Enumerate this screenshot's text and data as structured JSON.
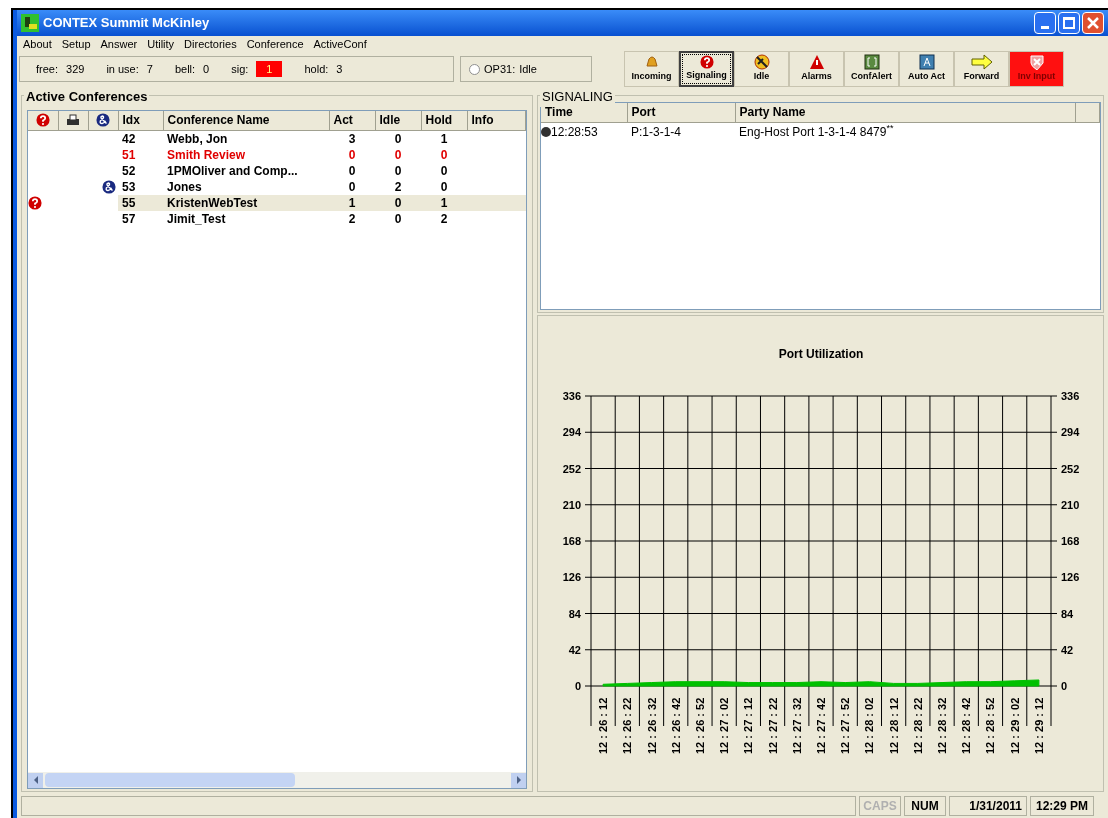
{
  "window": {
    "title": "CONTEX Summit McKinley"
  },
  "menu": [
    "About",
    "Setup",
    "Answer",
    "Utility",
    "Directories",
    "Conference",
    "ActiveConf"
  ],
  "counters": [
    {
      "label": "free:",
      "value": "329",
      "alert": false
    },
    {
      "label": "in use:",
      "value": "7",
      "alert": false
    },
    {
      "label": "bell:",
      "value": "0",
      "alert": false
    },
    {
      "label": "sig:",
      "value": "1",
      "alert": true
    },
    {
      "label": "hold:",
      "value": "3",
      "alert": false
    }
  ],
  "operator": {
    "label": "OP31:",
    "status": "Idle",
    "selected": false
  },
  "toolbar": [
    {
      "kind": "bell",
      "label": "Incoming",
      "selected": false,
      "alert": false
    },
    {
      "kind": "question",
      "label": "Signaling",
      "selected": true,
      "alert": false
    },
    {
      "kind": "idle",
      "label": "Idle",
      "selected": false,
      "alert": false
    },
    {
      "kind": "warning",
      "label": "Alarms",
      "selected": false,
      "alert": false
    },
    {
      "kind": "conf",
      "label": "ConfAlert",
      "selected": false,
      "alert": false
    },
    {
      "kind": "auto",
      "label": "Auto Act",
      "selected": false,
      "alert": false
    },
    {
      "kind": "arrow",
      "label": "Forward",
      "selected": false,
      "alert": false
    },
    {
      "kind": "shield",
      "label": "Inv Input",
      "selected": false,
      "alert": true
    }
  ],
  "conferences": {
    "title": "Active Conferences",
    "columns": [
      "Idx",
      "Conference Name",
      "Act",
      "Idle",
      "Hold",
      "Info"
    ],
    "rows": [
      {
        "question": false,
        "ampersand": false,
        "idx": "42",
        "name": "Webb, Jon",
        "act": "3",
        "idle": "0",
        "hold": "1",
        "alert": false,
        "selected": false
      },
      {
        "question": false,
        "ampersand": false,
        "idx": "51",
        "name": "Smith Review",
        "act": "0",
        "idle": "0",
        "hold": "0",
        "alert": true,
        "selected": false
      },
      {
        "question": false,
        "ampersand": false,
        "idx": "52",
        "name": "1PMOliver and Comp...",
        "act": "0",
        "idle": "0",
        "hold": "0",
        "alert": false,
        "selected": false
      },
      {
        "question": false,
        "ampersand": true,
        "idx": "53",
        "name": "Jones",
        "act": "0",
        "idle": "2",
        "hold": "0",
        "alert": false,
        "selected": false
      },
      {
        "question": true,
        "ampersand": false,
        "idx": "55",
        "name": "KristenWebTest",
        "act": "1",
        "idle": "0",
        "hold": "1",
        "alert": false,
        "selected": true
      },
      {
        "question": false,
        "ampersand": false,
        "idx": "57",
        "name": "Jimit_Test",
        "act": "2",
        "idle": "0",
        "hold": "2",
        "alert": false,
        "selected": false
      }
    ]
  },
  "signaling": {
    "title": "SIGNALING",
    "columns": [
      "Time",
      "Port",
      "Party Name"
    ],
    "rows": [
      {
        "time": "12:28:53",
        "port": "P:1-3-1-4",
        "party": "Eng-Host Port 1-3-1-4 8479$^{**}$"
      }
    ]
  },
  "chart": {
    "chart_data": {
      "type": "area",
      "title": "Port Utilization",
      "categories": [
        "12 : 26 : 12",
        "12 : 26 : 22",
        "12 : 26 : 32",
        "12 : 26 : 42",
        "12 : 26 : 52",
        "12 : 27 : 02",
        "12 : 27 : 12",
        "12 : 27 : 22",
        "12 : 27 : 32",
        "12 : 27 : 42",
        "12 : 27 : 52",
        "12 : 28 : 02",
        "12 : 28 : 12",
        "12 : 28 : 22",
        "12 : 28 : 32",
        "12 : 28 : 42",
        "12 : 28 : 52",
        "12 : 29 : 02",
        "12 : 29 : 12"
      ],
      "grid": true,
      "series": [
        {
          "color": "#00c000",
          "values": [
            2,
            3,
            4,
            5,
            5,
            5,
            4,
            4,
            4,
            5,
            4,
            5,
            3,
            3,
            4,
            5,
            5,
            6,
            7
          ]
        }
      ],
      "ylim": [
        0,
        336
      ],
      "yticks": [
        0,
        42,
        84,
        126,
        168,
        210,
        252,
        294,
        336
      ]
    },
    "right_axis_labels": [
      "336",
      "294",
      "252",
      "210",
      "168",
      "126",
      "84",
      "42",
      "0"
    ]
  },
  "status_bar": {
    "indicators": [
      {
        "label": "CAPS",
        "on": false
      },
      {
        "label": "NUM",
        "on": true
      }
    ],
    "date": "1/31/2011",
    "time": "12:29 PM"
  }
}
